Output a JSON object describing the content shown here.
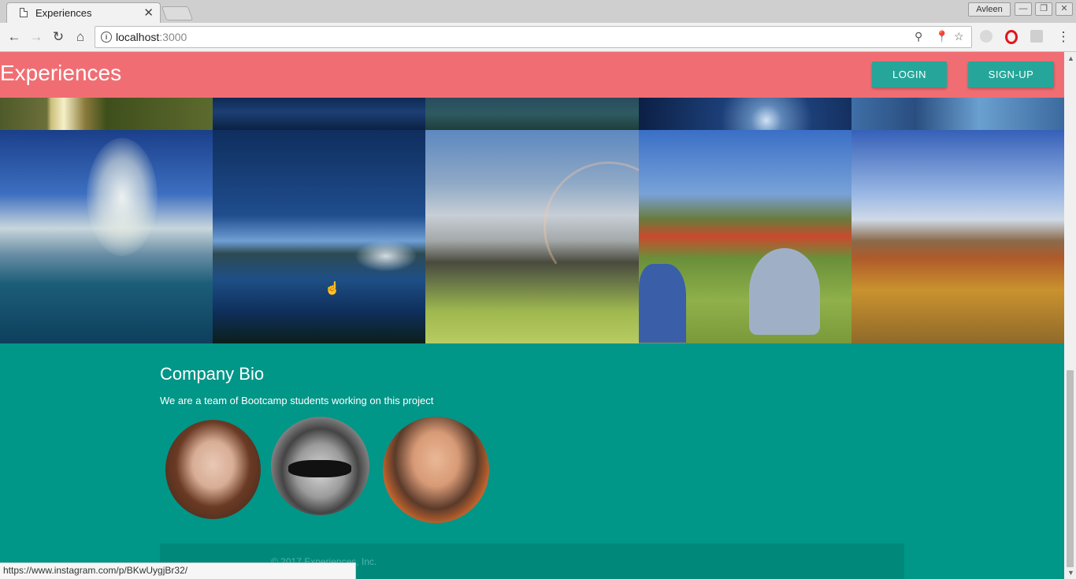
{
  "browser": {
    "tab_title": "Experiences",
    "profile_name": "Avleen",
    "url_host": "localhost",
    "url_port": ":3000",
    "status_url": "https://www.instagram.com/p/BKwUygjBr32/"
  },
  "navbar": {
    "brand": "Experiences",
    "login_label": "LOGIN",
    "signup_label": "SIGN-UP",
    "background": "#f06e73",
    "button_color": "#26a69a"
  },
  "gallery": {
    "photos": [
      "lamp-photo",
      "lake-photo",
      "water-photo",
      "harbor-photo",
      "car-photo",
      "waterfall-photo",
      "niagara-river-photo",
      "rainbow-ranch-photo",
      "campsite-tents-photo",
      "red-rock-canyon-photo"
    ]
  },
  "footer": {
    "title": "Company Bio",
    "text": "We are a team of Bootcamp students working on this project",
    "copyright": "© 2017 Experiences, Inc.",
    "background": "#009688"
  }
}
